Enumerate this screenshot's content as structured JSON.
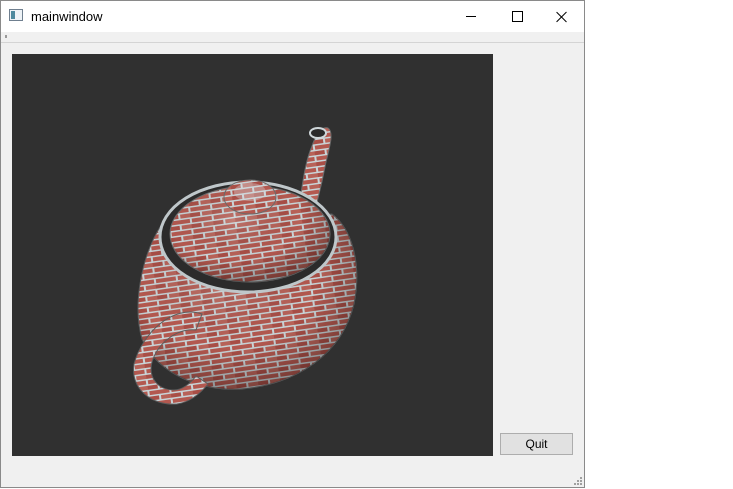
{
  "window": {
    "title": "mainwindow"
  },
  "render": {
    "model": "teapot",
    "texture": "brick",
    "background_color": "#303030"
  },
  "buttons": {
    "quit_label": "Quit"
  },
  "icons": {
    "app": "app-icon",
    "minimize": "minimize-icon",
    "maximize": "maximize-icon",
    "close": "close-icon",
    "size_grip": "size-grip-icon"
  }
}
